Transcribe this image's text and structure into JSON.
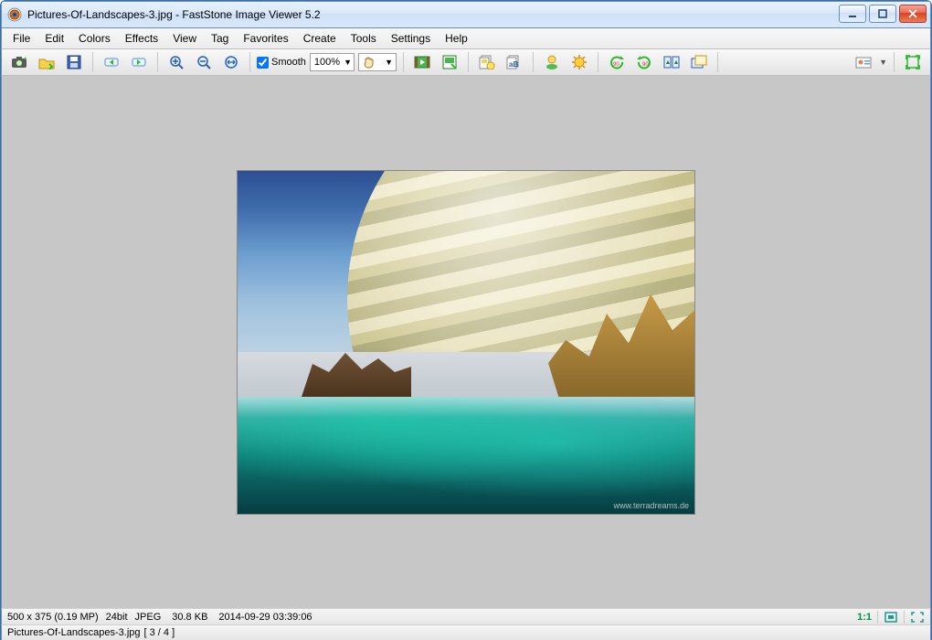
{
  "title": "Pictures-Of-Landscapes-3.jpg  -  FastStone Image Viewer 5.2",
  "menu": [
    "File",
    "Edit",
    "Colors",
    "Effects",
    "View",
    "Tag",
    "Favorites",
    "Create",
    "Tools",
    "Settings",
    "Help"
  ],
  "smooth_label": "Smooth",
  "smooth_checked": true,
  "zoom": "100%",
  "watermark": "www.terradreams.de",
  "status": {
    "dimensions": "500 x 375 (0.19 MP)",
    "depth": "24bit",
    "format": "JPEG",
    "size": "30.8 KB",
    "timestamp": "2014-09-29 03:39:06",
    "ratio": "1:1"
  },
  "status2": {
    "filename": "Pictures-Of-Landscapes-3.jpg",
    "position": "[ 3 / 4 ]"
  },
  "toolbar_icons": [
    "capture",
    "open-folder",
    "save",
    "prev",
    "next",
    "zoom-in",
    "zoom-out",
    "fit",
    "smooth",
    "zoom",
    "hand",
    "slideshow",
    "contact-sheet",
    "batch-convert",
    "batch-rename",
    "email",
    "sun-adjust",
    "rotate-left",
    "rotate-right",
    "compare",
    "clone",
    "contact-card",
    "fullscreen"
  ]
}
